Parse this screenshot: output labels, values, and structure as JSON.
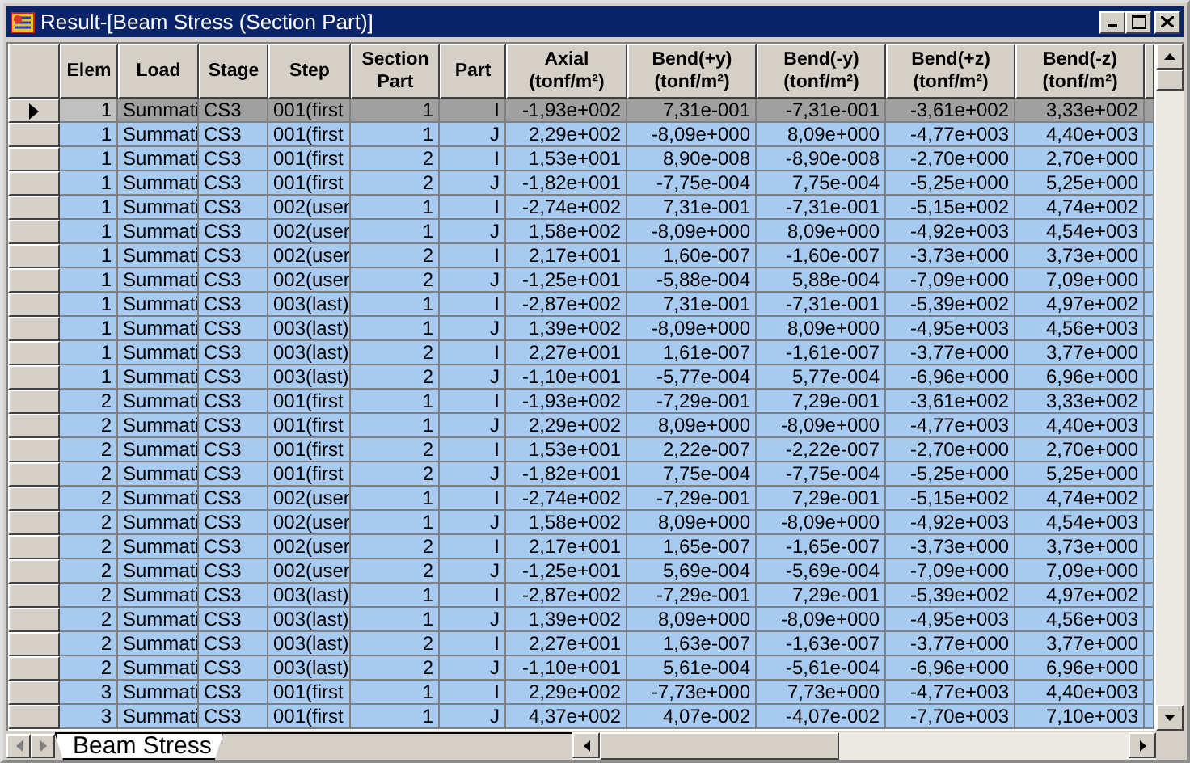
{
  "window": {
    "title": "Result-[Beam Stress (Section Part)]"
  },
  "columns": [
    {
      "label": "Elem"
    },
    {
      "label": "Load"
    },
    {
      "label": "Stage"
    },
    {
      "label": "Step"
    },
    {
      "label": "Section\nPart"
    },
    {
      "label": "Part"
    },
    {
      "label": "Axial\n(tonf/m²)"
    },
    {
      "label": "Bend(+y)\n(tonf/m²)"
    },
    {
      "label": "Bend(-y)\n(tonf/m²)"
    },
    {
      "label": "Bend(+z)\n(tonf/m²)"
    },
    {
      "label": "Bend(-z)\n(tonf/m²)"
    }
  ],
  "rows": [
    {
      "selected": true,
      "cells": [
        "1",
        "Summati",
        "CS3",
        "001(first",
        "1",
        "I",
        "-1,93e+002",
        "7,31e-001",
        "-7,31e-001",
        "-3,61e+002",
        "3,33e+002"
      ]
    },
    {
      "selected": false,
      "cells": [
        "1",
        "Summati",
        "CS3",
        "001(first",
        "1",
        "J",
        "2,29e+002",
        "-8,09e+000",
        "8,09e+000",
        "-4,77e+003",
        "4,40e+003"
      ]
    },
    {
      "selected": false,
      "cells": [
        "1",
        "Summati",
        "CS3",
        "001(first",
        "2",
        "I",
        "1,53e+001",
        "8,90e-008",
        "-8,90e-008",
        "-2,70e+000",
        "2,70e+000"
      ]
    },
    {
      "selected": false,
      "cells": [
        "1",
        "Summati",
        "CS3",
        "001(first",
        "2",
        "J",
        "-1,82e+001",
        "-7,75e-004",
        "7,75e-004",
        "-5,25e+000",
        "5,25e+000"
      ]
    },
    {
      "selected": false,
      "cells": [
        "1",
        "Summati",
        "CS3",
        "002(user",
        "1",
        "I",
        "-2,74e+002",
        "7,31e-001",
        "-7,31e-001",
        "-5,15e+002",
        "4,74e+002"
      ]
    },
    {
      "selected": false,
      "cells": [
        "1",
        "Summati",
        "CS3",
        "002(user",
        "1",
        "J",
        "1,58e+002",
        "-8,09e+000",
        "8,09e+000",
        "-4,92e+003",
        "4,54e+003"
      ]
    },
    {
      "selected": false,
      "cells": [
        "1",
        "Summati",
        "CS3",
        "002(user",
        "2",
        "I",
        "2,17e+001",
        "1,60e-007",
        "-1,60e-007",
        "-3,73e+000",
        "3,73e+000"
      ]
    },
    {
      "selected": false,
      "cells": [
        "1",
        "Summati",
        "CS3",
        "002(user",
        "2",
        "J",
        "-1,25e+001",
        "-5,88e-004",
        "5,88e-004",
        "-7,09e+000",
        "7,09e+000"
      ]
    },
    {
      "selected": false,
      "cells": [
        "1",
        "Summati",
        "CS3",
        "003(last)",
        "1",
        "I",
        "-2,87e+002",
        "7,31e-001",
        "-7,31e-001",
        "-5,39e+002",
        "4,97e+002"
      ]
    },
    {
      "selected": false,
      "cells": [
        "1",
        "Summati",
        "CS3",
        "003(last)",
        "1",
        "J",
        "1,39e+002",
        "-8,09e+000",
        "8,09e+000",
        "-4,95e+003",
        "4,56e+003"
      ]
    },
    {
      "selected": false,
      "cells": [
        "1",
        "Summati",
        "CS3",
        "003(last)",
        "2",
        "I",
        "2,27e+001",
        "1,61e-007",
        "-1,61e-007",
        "-3,77e+000",
        "3,77e+000"
      ]
    },
    {
      "selected": false,
      "cells": [
        "1",
        "Summati",
        "CS3",
        "003(last)",
        "2",
        "J",
        "-1,10e+001",
        "-5,77e-004",
        "5,77e-004",
        "-6,96e+000",
        "6,96e+000"
      ]
    },
    {
      "selected": false,
      "cells": [
        "2",
        "Summati",
        "CS3",
        "001(first",
        "1",
        "I",
        "-1,93e+002",
        "-7,29e-001",
        "7,29e-001",
        "-3,61e+002",
        "3,33e+002"
      ]
    },
    {
      "selected": false,
      "cells": [
        "2",
        "Summati",
        "CS3",
        "001(first",
        "1",
        "J",
        "2,29e+002",
        "8,09e+000",
        "-8,09e+000",
        "-4,77e+003",
        "4,40e+003"
      ]
    },
    {
      "selected": false,
      "cells": [
        "2",
        "Summati",
        "CS3",
        "001(first",
        "2",
        "I",
        "1,53e+001",
        "2,22e-007",
        "-2,22e-007",
        "-2,70e+000",
        "2,70e+000"
      ]
    },
    {
      "selected": false,
      "cells": [
        "2",
        "Summati",
        "CS3",
        "001(first",
        "2",
        "J",
        "-1,82e+001",
        "7,75e-004",
        "-7,75e-004",
        "-5,25e+000",
        "5,25e+000"
      ]
    },
    {
      "selected": false,
      "cells": [
        "2",
        "Summati",
        "CS3",
        "002(user",
        "1",
        "I",
        "-2,74e+002",
        "-7,29e-001",
        "7,29e-001",
        "-5,15e+002",
        "4,74e+002"
      ]
    },
    {
      "selected": false,
      "cells": [
        "2",
        "Summati",
        "CS3",
        "002(user",
        "1",
        "J",
        "1,58e+002",
        "8,09e+000",
        "-8,09e+000",
        "-4,92e+003",
        "4,54e+003"
      ]
    },
    {
      "selected": false,
      "cells": [
        "2",
        "Summati",
        "CS3",
        "002(user",
        "2",
        "I",
        "2,17e+001",
        "1,65e-007",
        "-1,65e-007",
        "-3,73e+000",
        "3,73e+000"
      ]
    },
    {
      "selected": false,
      "cells": [
        "2",
        "Summati",
        "CS3",
        "002(user",
        "2",
        "J",
        "-1,25e+001",
        "5,69e-004",
        "-5,69e-004",
        "-7,09e+000",
        "7,09e+000"
      ]
    },
    {
      "selected": false,
      "cells": [
        "2",
        "Summati",
        "CS3",
        "003(last)",
        "1",
        "I",
        "-2,87e+002",
        "-7,29e-001",
        "7,29e-001",
        "-5,39e+002",
        "4,97e+002"
      ]
    },
    {
      "selected": false,
      "cells": [
        "2",
        "Summati",
        "CS3",
        "003(last)",
        "1",
        "J",
        "1,39e+002",
        "8,09e+000",
        "-8,09e+000",
        "-4,95e+003",
        "4,56e+003"
      ]
    },
    {
      "selected": false,
      "cells": [
        "2",
        "Summati",
        "CS3",
        "003(last)",
        "2",
        "I",
        "2,27e+001",
        "1,63e-007",
        "-1,63e-007",
        "-3,77e+000",
        "3,77e+000"
      ]
    },
    {
      "selected": false,
      "cells": [
        "2",
        "Summati",
        "CS3",
        "003(last)",
        "2",
        "J",
        "-1,10e+001",
        "5,61e-004",
        "-5,61e-004",
        "-6,96e+000",
        "6,96e+000"
      ]
    },
    {
      "selected": false,
      "cells": [
        "3",
        "Summati",
        "CS3",
        "001(first",
        "1",
        "I",
        "2,29e+002",
        "-7,73e+000",
        "7,73e+000",
        "-4,77e+003",
        "4,40e+003"
      ]
    },
    {
      "selected": false,
      "cells": [
        "3",
        "Summati",
        "CS3",
        "001(first",
        "1",
        "J",
        "4,37e+002",
        "4,07e-002",
        "-4,07e-002",
        "-7,70e+003",
        "7,10e+003"
      ]
    }
  ],
  "sheet_tabs": [
    {
      "label": "Beam Stress",
      "selected": true
    }
  ]
}
